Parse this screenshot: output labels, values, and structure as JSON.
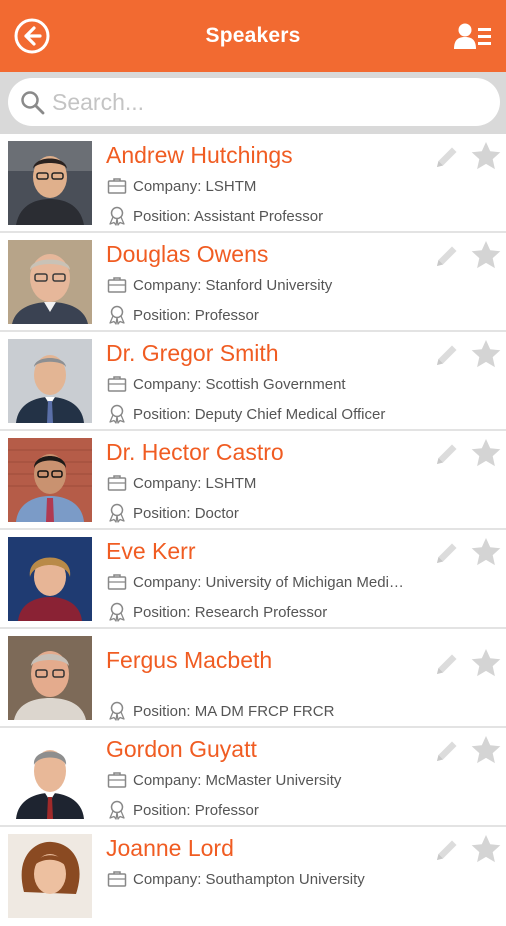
{
  "header": {
    "title": "Speakers",
    "accent_color": "#f26a31",
    "back_icon": "back-arrow-circle-icon",
    "right_icon": "contact-list-icon"
  },
  "search": {
    "placeholder": "Search...",
    "value": ""
  },
  "speakers": [
    {
      "name": "Andrew Hutchings",
      "company": "Company: LSHTM",
      "position": "Position: Assistant Professor"
    },
    {
      "name": "Douglas Owens",
      "company": "Company: Stanford University",
      "position": "Position: Professor"
    },
    {
      "name": "Dr. Gregor Smith",
      "company": "Company: Scottish Government",
      "position": "Position: Deputy Chief Medical Officer"
    },
    {
      "name": "Dr. Hector Castro",
      "company": "Company: LSHTM",
      "position": "Position: Doctor"
    },
    {
      "name": "Eve Kerr",
      "company": "Company: University of Michigan Medi…",
      "position": "Position: Research Professor"
    },
    {
      "name": "Fergus Macbeth",
      "company": "",
      "position": "Position: MA DM FRCP FRCR"
    },
    {
      "name": "Gordon Guyatt",
      "company": "Company: McMaster University",
      "position": "Position: Professor"
    },
    {
      "name": "Joanne Lord",
      "company": "Company: Southampton University",
      "position": ""
    }
  ]
}
